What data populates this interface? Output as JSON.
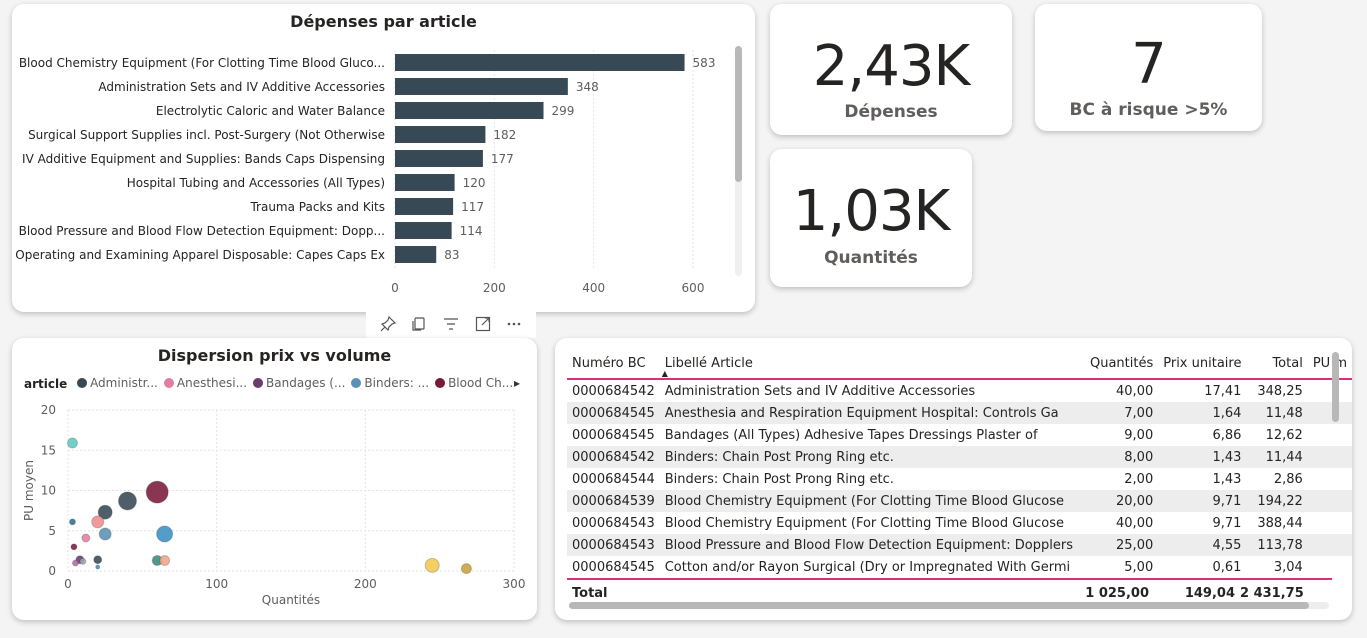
{
  "bar_card": {
    "title": "Dépenses par article",
    "chart_data": {
      "type": "bar",
      "orientation": "horizontal",
      "title": "Dépenses par article",
      "categories": [
        "Blood Chemistry Equipment (For Clotting Time Blood Gluco...",
        "Administration Sets and IV Additive Accessories",
        "Electrolytic Caloric and Water Balance",
        "Surgical Support Supplies incl. Post-Surgery (Not Otherwise",
        "IV Additive Equipment and Supplies: Bands Caps Dispensing",
        "Hospital Tubing and Accessories (All Types)",
        "Trauma Packs and Kits",
        "Blood Pressure and Blood Flow Detection Equipment: Dopp...",
        "Operating and Examining Apparel Disposable: Capes Caps Ex"
      ],
      "values": [
        583,
        348,
        299,
        182,
        177,
        120,
        117,
        114,
        83
      ],
      "xlim": [
        0,
        600
      ],
      "xticks": [
        "0",
        "200",
        "400",
        "600"
      ],
      "bar_color": "#374955"
    }
  },
  "kpis": {
    "depenses": {
      "value": "2,43K",
      "label": "Dépenses"
    },
    "bc_risque": {
      "value": "7",
      "label": "BC à risque >5%"
    },
    "quantites": {
      "value": "1,03K",
      "label": "Quantités"
    }
  },
  "scatter_card": {
    "title": "Dispersion prix vs volume",
    "legend_title": "article",
    "legend": [
      {
        "label": "Administr...",
        "color": "#374955"
      },
      {
        "label": "Anesthesi...",
        "color": "#e07fa3"
      },
      {
        "label": "Bandages (...",
        "color": "#6b3a6e"
      },
      {
        "label": "Binders: ...",
        "color": "#5a91b4"
      },
      {
        "label": "Blood Ch...",
        "color": "#7a1a3a"
      }
    ],
    "chart_data": {
      "type": "scatter",
      "title": "Dispersion prix vs volume",
      "xlabel": "Quantités",
      "ylabel": "PU moyen",
      "xlim": [
        0,
        300
      ],
      "ylim": [
        0,
        20
      ],
      "xticks": [
        "0",
        "100",
        "200",
        "300"
      ],
      "yticks": [
        "0",
        "5",
        "10",
        "15",
        "20"
      ],
      "points": [
        {
          "x": 60,
          "y": 9.8,
          "r": 11,
          "color": "#7a1a3a"
        },
        {
          "x": 40,
          "y": 8.7,
          "r": 9,
          "color": "#374955"
        },
        {
          "x": 25,
          "y": 7.3,
          "r": 7,
          "color": "#374955"
        },
        {
          "x": 65,
          "y": 4.6,
          "r": 8,
          "color": "#3a8fc1"
        },
        {
          "x": 25,
          "y": 4.6,
          "r": 6,
          "color": "#5a91b4"
        },
        {
          "x": 20,
          "y": 6.1,
          "r": 6,
          "color": "#f08c8c"
        },
        {
          "x": 3,
          "y": 15.9,
          "r": 5,
          "color": "#5ec8c0"
        },
        {
          "x": 3,
          "y": 6.1,
          "r": 3,
          "color": "#2f6f8f"
        },
        {
          "x": 12,
          "y": 4.1,
          "r": 4,
          "color": "#e07fa3"
        },
        {
          "x": 8,
          "y": 1.4,
          "r": 4,
          "color": "#6b3a6e"
        },
        {
          "x": 20,
          "y": 1.4,
          "r": 4,
          "color": "#374955"
        },
        {
          "x": 60,
          "y": 1.3,
          "r": 5,
          "color": "#3a8a7e"
        },
        {
          "x": 65,
          "y": 1.3,
          "r": 5,
          "color": "#f0a48a"
        },
        {
          "x": 4,
          "y": 3.0,
          "r": 3,
          "color": "#7a1a3a"
        },
        {
          "x": 5,
          "y": 1.0,
          "r": 3,
          "color": "#b06b9c"
        },
        {
          "x": 10,
          "y": 1.2,
          "r": 3,
          "color": "#9aa7b0"
        },
        {
          "x": 20,
          "y": 0.5,
          "r": 2,
          "color": "#3a8fc1"
        },
        {
          "x": 245,
          "y": 0.7,
          "r": 7,
          "color": "#f1c84f"
        },
        {
          "x": 268,
          "y": 0.3,
          "r": 5,
          "color": "#c9a23a"
        }
      ]
    }
  },
  "table_card": {
    "columns": [
      "Numéro BC",
      "Libellé Article",
      "Quantités",
      "Prix unitaire",
      "Total",
      "PU m"
    ],
    "rows": [
      [
        "0000684542",
        "Administration Sets and IV Additive Accessories",
        "40,00",
        "17,41",
        "348,25"
      ],
      [
        "0000684545",
        "Anesthesia and Respiration Equipment Hospital: Controls Ga",
        "7,00",
        "1,64",
        "11,48"
      ],
      [
        "0000684545",
        "Bandages (All Types) Adhesive Tapes Dressings Plaster of",
        "9,00",
        "6,86",
        "12,62"
      ],
      [
        "0000684542",
        "Binders: Chain Post Prong Ring etc.",
        "8,00",
        "1,43",
        "11,44"
      ],
      [
        "0000684544",
        "Binders: Chain Post Prong Ring etc.",
        "2,00",
        "1,43",
        "2,86"
      ],
      [
        "0000684539",
        "Blood Chemistry Equipment (For Clotting Time Blood Glucose",
        "20,00",
        "9,71",
        "194,22"
      ],
      [
        "0000684543",
        "Blood Chemistry Equipment (For Clotting Time Blood Glucose",
        "40,00",
        "9,71",
        "388,44"
      ],
      [
        "0000684543",
        "Blood Pressure and Blood Flow Detection Equipment: Dopplers",
        "25,00",
        "4,55",
        "113,78"
      ],
      [
        "0000684545",
        "Cotton and/or Rayon Surgical (Dry or Impregnated With Germi",
        "5,00",
        "0,61",
        "3,04"
      ]
    ],
    "total": {
      "label": "Total",
      "quantites": "1 025,00",
      "prix": "149,04",
      "total": "2 431,75"
    }
  },
  "toolbar": {
    "icons": [
      "pin-icon",
      "copy-icon",
      "filter-icon",
      "focus-mode-icon",
      "more-options-icon"
    ]
  }
}
